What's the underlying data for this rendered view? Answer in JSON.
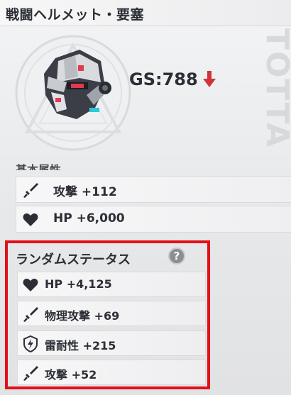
{
  "item": {
    "name": "戦闘ヘルメット・要塞",
    "gs_text": "GS:788",
    "gs_trend": "down"
  },
  "base_stats": {
    "section_label": "基本属性",
    "rows": [
      {
        "icon": "sword-icon",
        "text": "攻撃 +112"
      },
      {
        "icon": "heart-icon",
        "text": "HP +6,000"
      }
    ]
  },
  "random_stats": {
    "title": "ランダムステータス",
    "help_label": "?",
    "rows": [
      {
        "icon": "heart-icon",
        "text": "HP +4,125"
      },
      {
        "icon": "sword-icon",
        "text": "物理攻撃 +69"
      },
      {
        "icon": "lightning-shield-icon",
        "text": "雷耐性 +215"
      },
      {
        "icon": "sword-icon",
        "text": "攻撃 +52"
      }
    ]
  },
  "colors": {
    "highlight_border": "#e3101a",
    "down_arrow": "#d2333a",
    "text": "#2b2e35"
  }
}
